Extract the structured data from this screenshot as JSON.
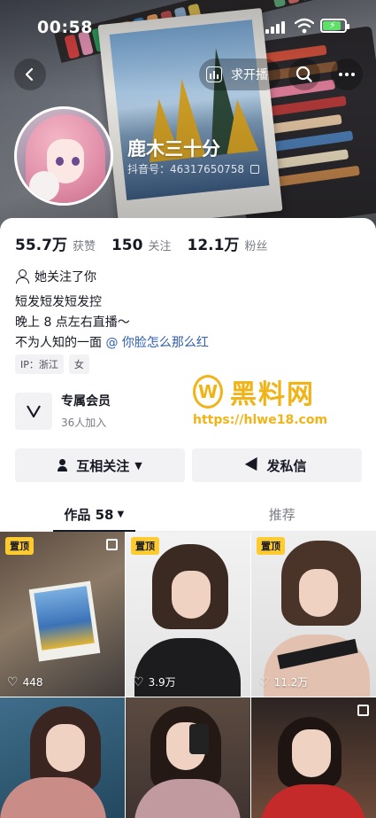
{
  "status_bar": {
    "time": "00:58"
  },
  "nav": {
    "live_request_label": "求开播"
  },
  "profile": {
    "name": "鹿木三十分",
    "douyin_id": "抖音号：46317650758"
  },
  "stats": [
    {
      "value": "55.7万",
      "label": "获赞"
    },
    {
      "value": "150",
      "label": "关注"
    },
    {
      "value": "12.1万",
      "label": "粉丝"
    }
  ],
  "follows_you": "她关注了你",
  "bio": {
    "line1": "短发短发短发控",
    "line2": "晚上 8 点左右直播～",
    "line3_prefix": "不为人知的一面 ",
    "line3_mention": "@ 你脸怎么那么红"
  },
  "tags": [
    "IP：浙江",
    "女"
  ],
  "member": {
    "title": "专属会员",
    "subtitle": "36人加入"
  },
  "watermark": {
    "logo_mark": "W",
    "text": "黑料网",
    "url": "https://hlwe18.com"
  },
  "actions": {
    "mutual_follow": "互相关注",
    "send_message": "发私信"
  },
  "tabs": [
    {
      "label": "作品 58",
      "active": true
    },
    {
      "label": "推荐",
      "active": false
    }
  ],
  "posts": [
    {
      "pinned": true,
      "pin_label": "置顶",
      "multi": true,
      "likes": "448"
    },
    {
      "pinned": true,
      "pin_label": "置顶",
      "multi": false,
      "likes": "3.9万"
    },
    {
      "pinned": true,
      "pin_label": "置顶",
      "multi": false,
      "likes": "11.2万"
    },
    {
      "pinned": false,
      "multi": false,
      "likes": ""
    },
    {
      "pinned": false,
      "multi": false,
      "likes": ""
    },
    {
      "pinned": false,
      "multi": true,
      "likes": ""
    }
  ],
  "colors": {
    "pin_badge": "#fecb2f",
    "mention": "#2f5fb3",
    "watermark": "#f1b418",
    "text": "#161823",
    "muted": "#7a7c85"
  }
}
